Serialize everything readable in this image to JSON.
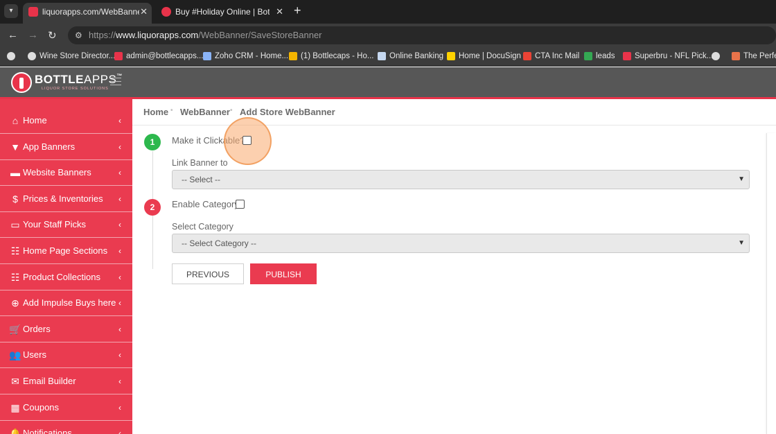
{
  "browser": {
    "tab_dropdown_icon": "chevron-down-icon",
    "tabs": [
      {
        "title": "liquorapps.com/WebBanner/Sa",
        "close": "✕",
        "active": true
      },
      {
        "title": "Buy #Holiday Online | Bottlecap",
        "close": "✕",
        "active": false
      }
    ],
    "new_tab": "+",
    "nav": {
      "back": "←",
      "forward": "→",
      "reload": "↻"
    },
    "url": {
      "prefix": "https://",
      "domain": "www.liquorapps.com",
      "path": "/WebBanner/SaveStoreBanner"
    },
    "bookmarks": [
      {
        "label": "",
        "icon": "globe-icon",
        "color": "#dddddd"
      },
      {
        "label": "Wine Store Director...",
        "icon": "globe-icon",
        "color": "#dddddd"
      },
      {
        "label": "admin@bottlecapps....",
        "icon": "bottlecapps-icon",
        "color": "#e8334a"
      },
      {
        "label": "Zoho CRM - Home...",
        "icon": "zoho-icon",
        "color": "#8ab4f8"
      },
      {
        "label": "(1) Bottlecaps - Ho...",
        "icon": "bottlecaps-icon",
        "color": "#f4b400"
      },
      {
        "label": "Online Banking",
        "icon": "document-icon",
        "color": "#c6d8f0"
      },
      {
        "label": "Home | DocuSign",
        "icon": "docusign-icon",
        "color": "#ffd200"
      },
      {
        "label": "CTA Inc Mail",
        "icon": "gmail-icon",
        "color": "#ea4335"
      },
      {
        "label": "leads",
        "icon": "sheets-icon",
        "color": "#34a853"
      },
      {
        "label": "Superbru - NFL Pick...",
        "icon": "superbru-icon",
        "color": "#e8334a"
      },
      {
        "label": "",
        "icon": "globe-icon",
        "color": "#dddddd"
      },
      {
        "label": "The Perfect",
        "icon": "diamond-icon",
        "color": "#e8734a"
      }
    ]
  },
  "app": {
    "logo_bold": "BOTTLE",
    "logo_light": "APPS",
    "logo_tm": "™",
    "logo_sub": "LIQUOR STORE SOLUTIONS",
    "accent": "#ea3b50"
  },
  "sidebar": {
    "items": [
      {
        "label": "Home",
        "icon": "home-icon",
        "glyph": "⌂"
      },
      {
        "label": "App Banners",
        "icon": "filter-icon",
        "glyph": "▼"
      },
      {
        "label": "Website Banners",
        "icon": "banner-icon",
        "glyph": "▬"
      },
      {
        "label": "Prices & Inventories",
        "icon": "dollar-icon",
        "glyph": "$"
      },
      {
        "label": "Your Staff Picks",
        "icon": "card-icon",
        "glyph": "▭"
      },
      {
        "label": "Home Page Sections",
        "icon": "clipboard-icon",
        "glyph": "☷"
      },
      {
        "label": "Product Collections",
        "icon": "clipboard-icon",
        "glyph": "☷"
      },
      {
        "label": "Add Impulse Buys here",
        "icon": "plus-circle-icon",
        "glyph": "⊕"
      },
      {
        "label": "Orders",
        "icon": "cart-icon",
        "glyph": "🛒"
      },
      {
        "label": "Users",
        "icon": "users-icon",
        "glyph": "👥"
      },
      {
        "label": "Email Builder",
        "icon": "email-icon",
        "glyph": "✉"
      },
      {
        "label": "Coupons",
        "icon": "coupon-icon",
        "glyph": "▦"
      },
      {
        "label": "Notifications",
        "icon": "bell-icon",
        "glyph": "🔔"
      }
    ],
    "chevron": "‹"
  },
  "breadcrumb": {
    "items": [
      "Home",
      "WebBanner",
      "Add Store WebBanner"
    ],
    "separator": "•"
  },
  "form": {
    "step1": {
      "number": "1",
      "clickable_label": "Make it Clickable?",
      "link_label": "Link Banner to",
      "link_value": "-- Select --"
    },
    "step2": {
      "number": "2",
      "category_label": "Enable Category",
      "select_label": "Select Category",
      "select_value": "-- Select Category --"
    },
    "caret": "⌄",
    "buttons": {
      "previous": "PREVIOUS",
      "publish": "PUBLISH"
    }
  }
}
